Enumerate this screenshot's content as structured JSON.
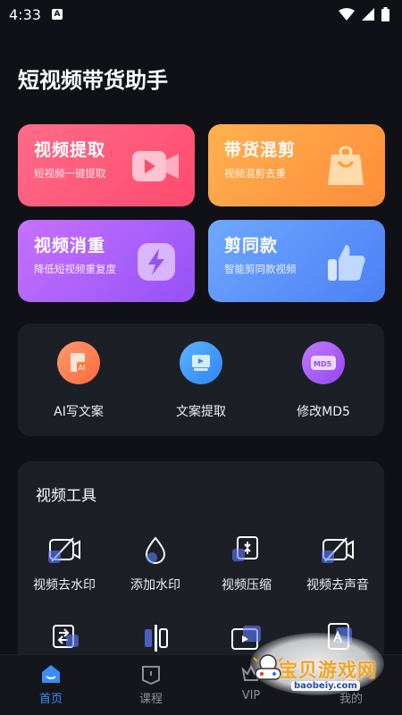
{
  "status_bar": {
    "time": "4:33",
    "app_badge": "A"
  },
  "page": {
    "title": "短视频带货助手"
  },
  "feature_cards": [
    {
      "title": "视频提取",
      "subtitle": "短视频一键提取",
      "icon": "play-video-icon"
    },
    {
      "title": "带货混剪",
      "subtitle": "视频混剪去重",
      "icon": "shopping-bag-icon"
    },
    {
      "title": "视频消重",
      "subtitle": "降低短视频重复度",
      "icon": "lightning-icon"
    },
    {
      "title": "剪同款",
      "subtitle": "智能剪同款视频",
      "icon": "thumbs-up-icon"
    }
  ],
  "quick_tools": [
    {
      "label": "AI写文案",
      "icon": "ai-document-icon"
    },
    {
      "label": "文案提取",
      "icon": "text-extract-icon"
    },
    {
      "label": "修改MD5",
      "icon": "md5-icon"
    }
  ],
  "video_tools": {
    "title": "视频工具",
    "items": [
      {
        "label": "视频去水印",
        "icon": "remove-watermark-icon"
      },
      {
        "label": "添加水印",
        "icon": "add-watermark-icon"
      },
      {
        "label": "视频压缩",
        "icon": "compress-video-icon"
      },
      {
        "label": "视频去声音",
        "icon": "mute-video-icon"
      }
    ],
    "partial_row_icons": [
      "reverse-video-icon",
      "split-video-icon",
      "film-icon",
      "text-video-icon"
    ]
  },
  "bottom_nav": [
    {
      "label": "首页",
      "icon": "home-icon",
      "active": true
    },
    {
      "label": "课程",
      "icon": "course-icon",
      "active": false
    },
    {
      "label": "VIP",
      "icon": "vip-icon",
      "active": false
    },
    {
      "label": "我的",
      "icon": "profile-icon",
      "active": false
    }
  ],
  "watermark": {
    "text": "宝贝游戏网",
    "url": "baobeiy.com"
  },
  "colors": {
    "background": "#0f1116",
    "panel": "#1c1f26",
    "active_nav": "#3b8cff",
    "card_red": "#ff5a78",
    "card_orange": "#ffa046",
    "card_purple": "#b062fa",
    "card_blue": "#5e92fa"
  }
}
